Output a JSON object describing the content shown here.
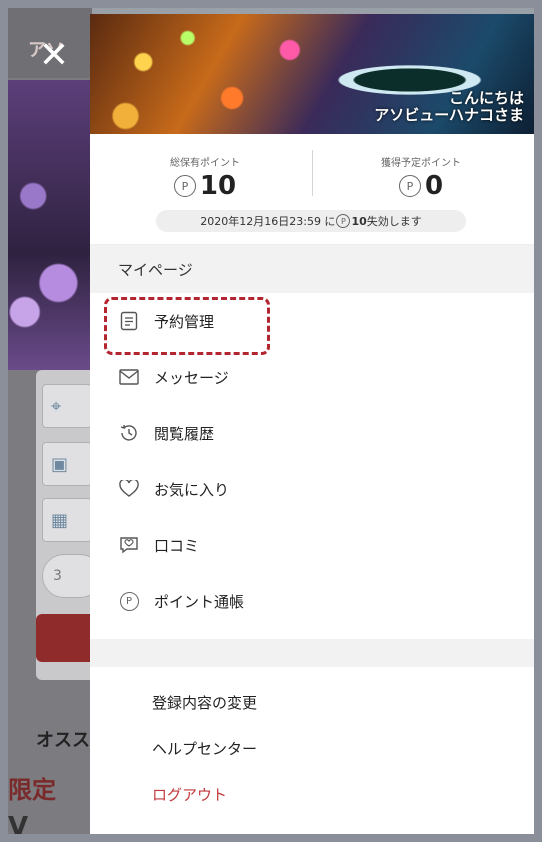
{
  "background": {
    "logo_text": "アソ",
    "section_title": "オスス",
    "limited_text": "限定",
    "bottom_text": "V",
    "coupon_text": "3"
  },
  "drawer": {
    "close_symbol": "✕",
    "greeting_line1": "こんにちは",
    "greeting_line2": "アソビューハナコさま",
    "points": {
      "owned_label": "総保有ポイント",
      "owned_value": "10",
      "scheduled_label": "獲得予定ポイント",
      "scheduled_value": "0",
      "point_symbol": "P",
      "expire_text": "2020年12月16日23:59 に",
      "expire_points": "10",
      "expire_suffix": "失効します"
    },
    "mypage_title": "マイページ",
    "menu": [
      {
        "label": "予約管理",
        "icon": "document-icon"
      },
      {
        "label": "メッセージ",
        "icon": "envelope-icon"
      },
      {
        "label": "閲覧履歴",
        "icon": "history-icon"
      },
      {
        "label": "お気に入り",
        "icon": "heart-icon"
      },
      {
        "label": "口コミ",
        "icon": "review-icon"
      },
      {
        "label": "ポイント通帳",
        "icon": "point-icon"
      }
    ],
    "sub_menu": [
      {
        "label": "登録内容の変更"
      },
      {
        "label": "ヘルプセンター"
      },
      {
        "label": "ログアウト"
      }
    ]
  },
  "colors": {
    "accent": "#b4262f",
    "logout": "#c0393e",
    "section_bg": "#f2f2f2"
  }
}
